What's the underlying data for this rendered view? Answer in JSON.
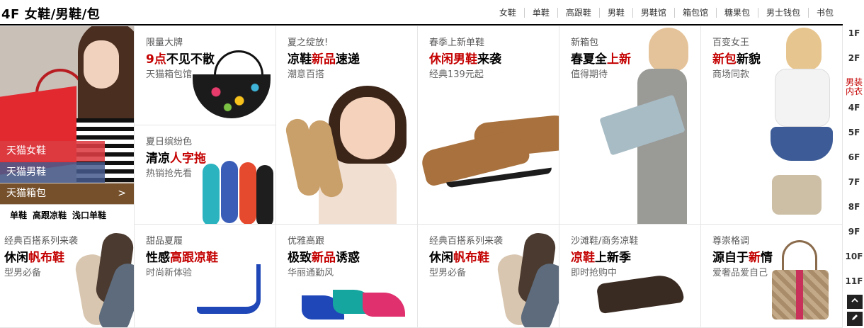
{
  "header": {
    "title": "4F 女鞋/男鞋/包",
    "nav": [
      "女鞋",
      "单鞋",
      "高跟鞋",
      "男鞋",
      "男鞋馆",
      "箱包馆",
      "糖果包",
      "男士钱包",
      "书包"
    ]
  },
  "left_panel": {
    "links": [
      "天猫女鞋",
      "天猫男鞋",
      "天猫箱包"
    ],
    "arrow": ">",
    "tags": [
      "单鞋",
      "高跟凉鞋",
      "浅口单鞋"
    ]
  },
  "cells": {
    "c1": {
      "sub": "限量大牌",
      "head_red": "9点",
      "head_rest": "不见不散",
      "tag": "天猫箱包馆"
    },
    "c2": {
      "sub": "夏日缤纷色",
      "head_pre": "清凉",
      "head_red": "人字拖",
      "tag": "热销抢先看"
    },
    "c3": {
      "sub": "夏之绽放!",
      "head_pre": "凉鞋",
      "head_red": "新品",
      "head_post": "速递",
      "tag": "潮意百搭"
    },
    "c4": {
      "sub": "春季上新单鞋",
      "head_red": "休闲男鞋",
      "head_post": "来袭",
      "tag": "经典139元起"
    },
    "c5": {
      "sub": "新箱包",
      "head_pre": "春夏全",
      "head_red": "上新",
      "tag": "值得期待"
    },
    "c6": {
      "sub": "百变女王",
      "head_red": "新包",
      "head_post": "新貌",
      "tag": "商场同款"
    },
    "c7": {
      "sub": "经典百搭系列来袭",
      "head_pre": "休闲",
      "head_red": "帆布鞋",
      "tag": "型男必备"
    },
    "c8": {
      "sub": "甜品夏履",
      "head_pre": "性感",
      "head_red": "高跟凉鞋",
      "tag": "时尚新体验"
    },
    "c9": {
      "sub": "优雅高跟",
      "head_pre": "极致",
      "head_red": "新品",
      "head_post": "诱惑",
      "tag": "华丽通勤风"
    },
    "c10": {
      "sub": "经典百搭系列来袭",
      "head_pre": "休闲",
      "head_red": "帆布鞋",
      "tag": "型男必备"
    },
    "c11": {
      "sub": "沙滩鞋/商务凉鞋",
      "head_red": "凉鞋",
      "head_post": "上新季",
      "tag": "即时抢购中"
    },
    "c12": {
      "sub": "尊崇格调",
      "head_pre": "源自于",
      "head_red": "新",
      "head_post": "情",
      "tag": "爱奢品爱自己"
    }
  },
  "floor_side": {
    "floors": [
      "1F",
      "2F",
      "男装\n内衣",
      "4F",
      "5F",
      "6F",
      "7F",
      "8F",
      "9F",
      "10F",
      "11F"
    ],
    "active_index": 2,
    "top_icon": "chevron-up-icon",
    "edit_icon": "pencil-icon"
  },
  "colors": {
    "accent_red": "#c40000",
    "border": "#e5e5e5"
  }
}
